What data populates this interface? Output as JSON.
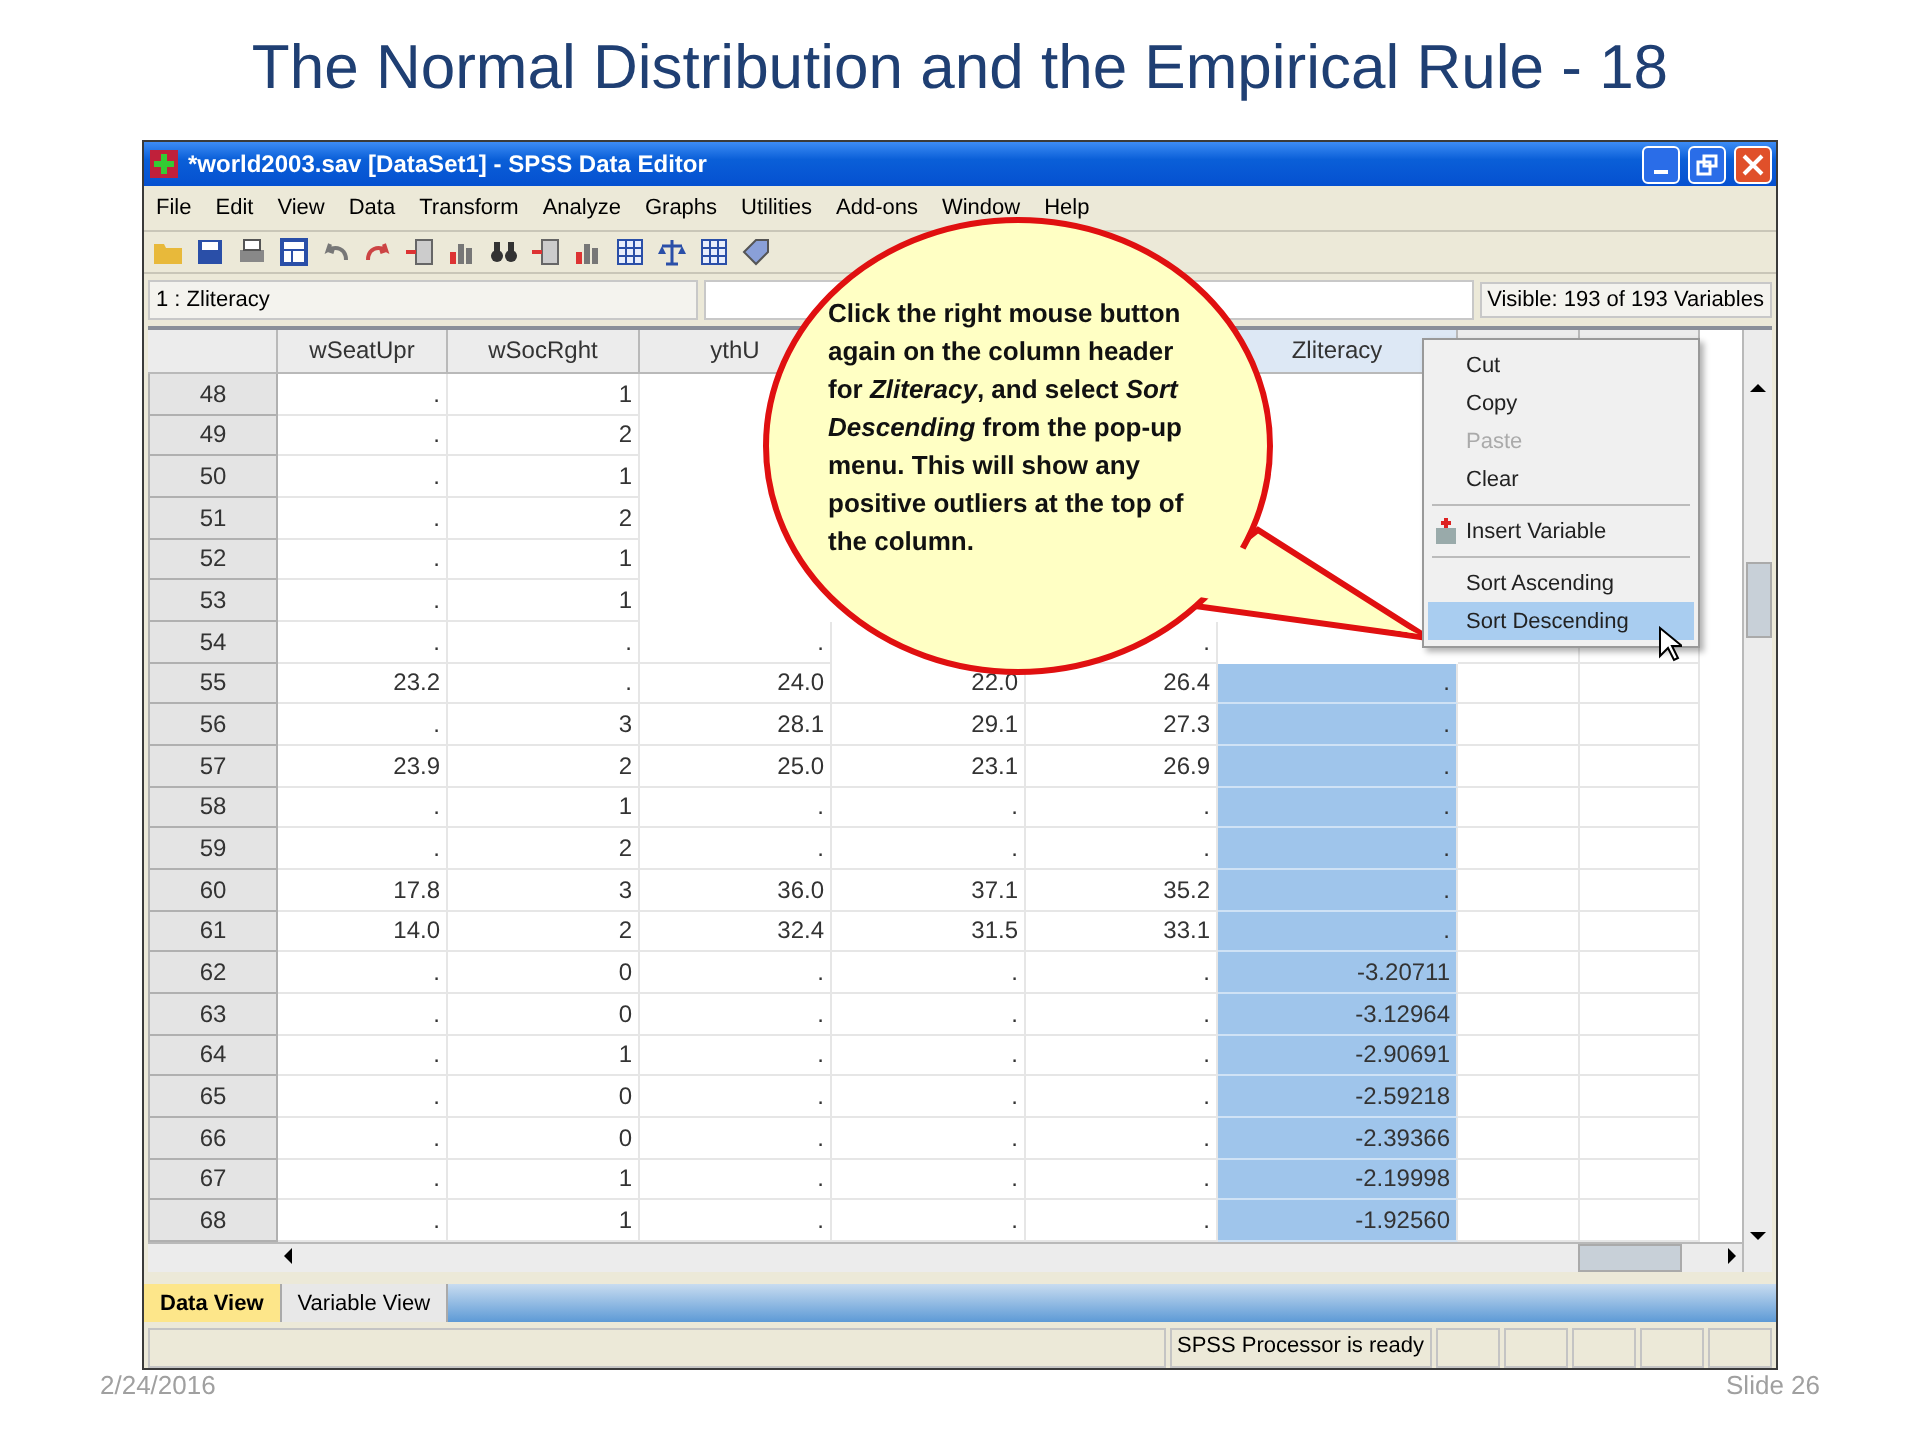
{
  "slide": {
    "title": "The Normal Distribution and the Empirical Rule - 18",
    "date": "2/24/2016",
    "slide_number": "Slide 26"
  },
  "window": {
    "title": "*world2003.sav [DataSet1] - SPSS Data Editor"
  },
  "menu": [
    "File",
    "Edit",
    "View",
    "Data",
    "Transform",
    "Analyze",
    "Graphs",
    "Utilities",
    "Add-ons",
    "Window",
    "Help"
  ],
  "cell_editor": {
    "cell": "1 : Zliteracy",
    "visible": "Visible: 193 of 193 Variables"
  },
  "grid": {
    "columns": [
      {
        "label": "wSeatUpr",
        "selected": false
      },
      {
        "label": "wSocRght",
        "selected": false
      },
      {
        "label": "ythU",
        "selected": false
      },
      {
        "selected": false
      },
      {
        "selected": false
      },
      {
        "label": "Zliteracy",
        "selected": true
      }
    ],
    "rows": [
      {
        "number": "48",
        "cells": [
          ".",
          "1",
          null,
          null,
          null,
          null
        ]
      },
      {
        "number": "49",
        "cells": [
          ".",
          "2",
          null,
          null,
          null,
          null
        ]
      },
      {
        "number": "50",
        "cells": [
          ".",
          "1",
          null,
          null,
          null,
          null
        ]
      },
      {
        "number": "51",
        "cells": [
          ".",
          "2",
          null,
          null,
          null,
          null
        ]
      },
      {
        "number": "52",
        "cells": [
          ".",
          "1",
          null,
          null,
          null,
          null
        ]
      },
      {
        "number": "53",
        "cells": [
          ".",
          "1",
          null,
          null,
          null,
          null
        ]
      },
      {
        "number": "54",
        "cells": [
          ".",
          ".",
          ".",
          null,
          ".",
          null
        ]
      },
      {
        "number": "55",
        "cells": [
          "23.2",
          ".",
          "24.0",
          "22.0",
          "26.4",
          "."
        ]
      },
      {
        "number": "56",
        "cells": [
          ".",
          "3",
          "28.1",
          "29.1",
          "27.3",
          "."
        ]
      },
      {
        "number": "57",
        "cells": [
          "23.9",
          "2",
          "25.0",
          "23.1",
          "26.9",
          "."
        ]
      },
      {
        "number": "58",
        "cells": [
          ".",
          "1",
          ".",
          ".",
          ".",
          "."
        ]
      },
      {
        "number": "59",
        "cells": [
          ".",
          "2",
          ".",
          ".",
          ".",
          "."
        ]
      },
      {
        "number": "60",
        "cells": [
          "17.8",
          "3",
          "36.0",
          "37.1",
          "35.2",
          "."
        ]
      },
      {
        "number": "61",
        "cells": [
          "14.0",
          "2",
          "32.4",
          "31.5",
          "33.1",
          "."
        ]
      },
      {
        "number": "62",
        "cells": [
          ".",
          "0",
          ".",
          ".",
          ".",
          "-3.20711"
        ]
      },
      {
        "number": "63",
        "cells": [
          ".",
          "0",
          ".",
          ".",
          ".",
          "-3.12964"
        ]
      },
      {
        "number": "64",
        "cells": [
          ".",
          "1",
          ".",
          ".",
          ".",
          "-2.90691"
        ]
      },
      {
        "number": "65",
        "cells": [
          ".",
          "0",
          ".",
          ".",
          ".",
          "-2.59218"
        ]
      },
      {
        "number": "66",
        "cells": [
          ".",
          "0",
          ".",
          ".",
          ".",
          "-2.39366"
        ]
      },
      {
        "number": "67",
        "cells": [
          ".",
          "1",
          ".",
          ".",
          ".",
          "-2.19998"
        ]
      },
      {
        "number": "68",
        "cells": [
          ".",
          "1",
          ".",
          ".",
          ".",
          "-1.92560"
        ]
      }
    ]
  },
  "view_tabs": [
    {
      "label": "Data View",
      "selected": true
    },
    {
      "label": "Variable View",
      "selected": false
    }
  ],
  "status_bar": {
    "message": "SPSS  Processor is ready"
  },
  "context_menu": [
    {
      "kind": "item",
      "label": "Cut",
      "disabled": false,
      "selected": false
    },
    {
      "kind": "item",
      "label": "Copy",
      "disabled": false,
      "selected": false
    },
    {
      "kind": "item",
      "label": "Paste",
      "disabled": true,
      "selected": false
    },
    {
      "kind": "item",
      "label": "Clear",
      "disabled": false,
      "selected": false
    },
    {
      "kind": "separator"
    },
    {
      "kind": "icon_item",
      "label": "Insert Variable",
      "disabled": false,
      "selected": false
    },
    {
      "kind": "separator"
    },
    {
      "kind": "item",
      "label": "Sort Ascending",
      "disabled": false,
      "selected": false
    },
    {
      "kind": "item",
      "label": "Sort Descending",
      "disabled": false,
      "selected": true
    }
  ],
  "callout": {
    "text": "Click the right mouse button again on the column header for *Zliteracy*, and select *Sort Descending* from the pop-up menu. This will show any positive outliers at the top of the column."
  }
}
